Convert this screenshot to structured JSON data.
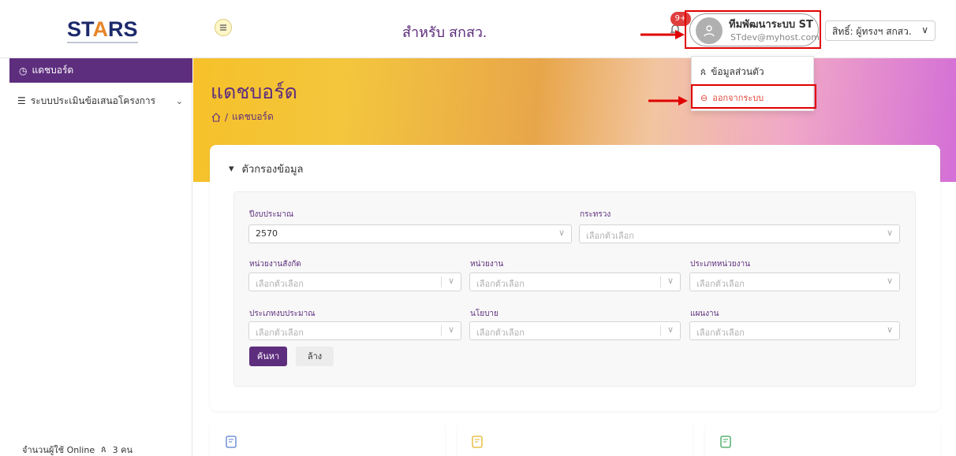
{
  "header": {
    "logo_text_left": "ST",
    "logo_text_a": "A",
    "logo_text_right": "RS",
    "title": "สำหรับ สกสว.",
    "notification_count": "9+",
    "user_name": "ทีมพัฒนาระบบ ST",
    "user_email": "STdev@myhost.com",
    "role_label": "สิทธิ์: ผู้ทรงฯ สกสว."
  },
  "user_menu": {
    "profile_label": "ข้อมูลส่วนตัว",
    "logout_label": "ออกจากระบบ"
  },
  "sidebar": {
    "active_item": "แดชบอร์ด",
    "item_evaluation": "ระบบประเมินข้อเสนอโครงการ",
    "online_label": "จำนวนผู้ใช้ Online",
    "online_count": "3 คน"
  },
  "page": {
    "title": "แดชบอร์ด",
    "breadcrumb_sep": "/",
    "breadcrumb_current": "แดชบอร์ด"
  },
  "filter": {
    "toggle_label": "ตัวกรองข้อมูล",
    "fiscal_year_label": "ปีงบประมาณ",
    "fiscal_year_value": "2570",
    "ministry_label": "กระทรวง",
    "affiliation_label": "หน่วยงานสังกัด",
    "agency_label": "หน่วยงาน",
    "agency_type_label": "ประเภทหน่วยงาน",
    "budget_type_label": "ประเภทงบประมาณ",
    "policy_label": "นโยบาย",
    "plan_label": "แผนงาน",
    "placeholder": "เลือกตัวเลือก",
    "search_button": "ค้นหา",
    "clear_button": "ล้าง"
  },
  "colors": {
    "brand_purple": "#5e2e7e",
    "annotation_red": "#e00000",
    "logout_red": "#e2473a"
  }
}
